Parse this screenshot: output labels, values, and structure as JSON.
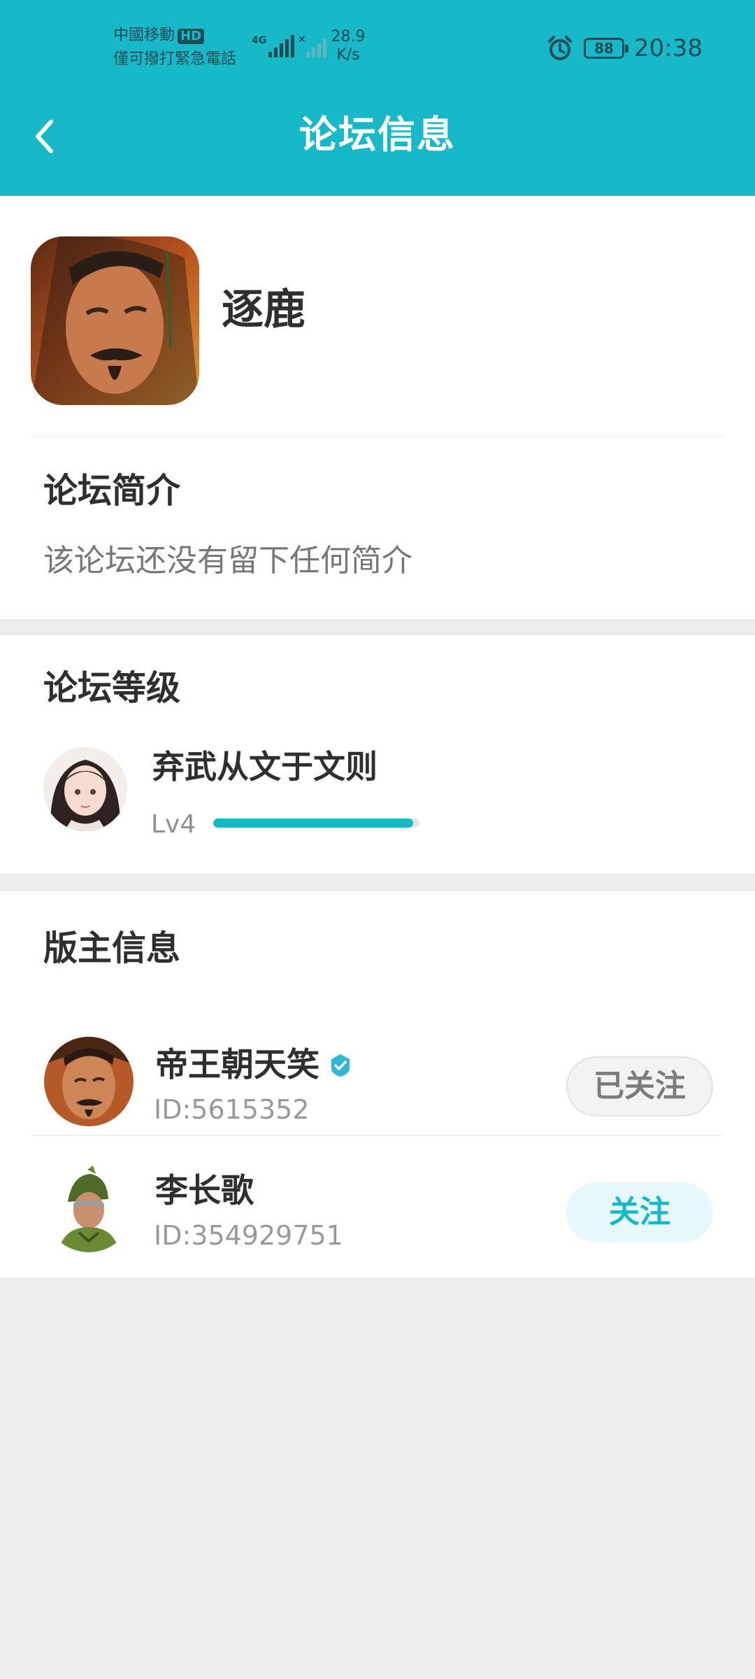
{
  "status_bar": {
    "carrier": "中國移動",
    "carrier_hd": "HD",
    "emergency": "僅可撥打緊急電話",
    "net_speed_value": "28.9",
    "net_speed_unit": "K/s",
    "battery": "88",
    "time": "20:38"
  },
  "header": {
    "title": "论坛信息"
  },
  "forum": {
    "name": "逐鹿"
  },
  "intro": {
    "title": "论坛简介",
    "text": "该论坛还没有留下任何简介"
  },
  "level": {
    "title": "论坛等级",
    "name": "弃武从文于文则",
    "level_code": "Lv4",
    "progress": 0.97
  },
  "moderators": {
    "title": "版主信息",
    "items": [
      {
        "name": "帝王朝天笑",
        "id": "ID:5615352",
        "button": "已关注",
        "verified": true
      },
      {
        "name": "李长歌",
        "id": "ID:354929751",
        "button": "关注",
        "verified": false
      }
    ]
  },
  "colors": {
    "accent": "#17b8c8",
    "background": "#ededed",
    "card": "#ffffff",
    "verified": "#33b6d6"
  },
  "icons": [
    "back-arrow-icon",
    "alarm-icon",
    "battery-icon",
    "signal-icon",
    "verified-badge-icon"
  ]
}
